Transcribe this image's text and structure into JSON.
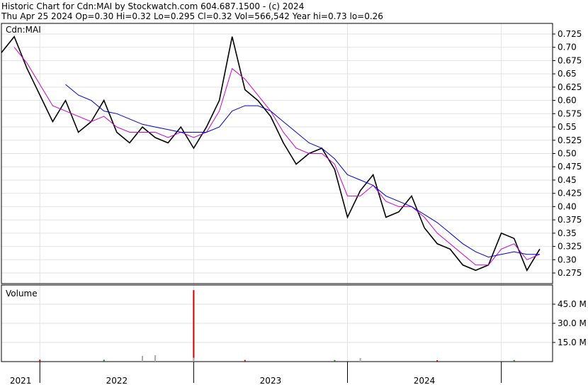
{
  "header": {
    "line1": "Historic Chart for Cdn:MAI by Stockwatch.com 604.687.1500 - (c) 2024",
    "line2": "Thu Apr 25 2024  Op=0.30  Hi=0.32  Lo=0.295  Cl=0.32  Vol=566,542  Year hi=0.73  lo=0.26"
  },
  "chart_data": {
    "type": "line",
    "symbol": "Cdn:MAI",
    "volume_label": "Volume",
    "price_axis": {
      "ticks": [
        "0.725",
        "0.70",
        "0.675",
        "0.65",
        "0.625",
        "0.60",
        "0.575",
        "0.55",
        "0.525",
        "0.50",
        "0.475",
        "0.45",
        "0.425",
        "0.40",
        "0.375",
        "0.35",
        "0.325",
        "0.30",
        "0.275"
      ],
      "ylim": [
        0.255,
        0.745
      ]
    },
    "volume_axis": {
      "ticks": [
        "45.0 M",
        "30.0 M",
        "15.0 M"
      ],
      "ylim": [
        0,
        60
      ]
    },
    "x_axis": {
      "labels": [
        "2021",
        "2022",
        "2023",
        "2024"
      ],
      "range": [
        "2020-10",
        "2024-05"
      ]
    },
    "grid": true,
    "series": [
      {
        "color": "#000000",
        "points": [
          [
            "2020-10",
            0.69
          ],
          [
            "2020-11",
            0.72
          ],
          [
            "2020-12",
            0.66
          ],
          [
            "2021-01",
            0.61
          ],
          [
            "2021-02",
            0.56
          ],
          [
            "2021-03",
            0.6
          ],
          [
            "2021-04",
            0.54
          ],
          [
            "2021-05",
            0.56
          ],
          [
            "2021-06",
            0.6
          ],
          [
            "2021-07",
            0.54
          ],
          [
            "2021-08",
            0.52
          ],
          [
            "2021-09",
            0.55
          ],
          [
            "2021-10",
            0.53
          ],
          [
            "2021-11",
            0.52
          ],
          [
            "2021-12",
            0.55
          ],
          [
            "2022-01",
            0.51
          ],
          [
            "2022-02",
            0.55
          ],
          [
            "2022-03",
            0.6
          ],
          [
            "2022-04",
            0.72
          ],
          [
            "2022-05",
            0.62
          ],
          [
            "2022-06",
            0.6
          ],
          [
            "2022-07",
            0.57
          ],
          [
            "2022-08",
            0.52
          ],
          [
            "2022-09",
            0.48
          ],
          [
            "2022-10",
            0.5
          ],
          [
            "2022-11",
            0.51
          ],
          [
            "2022-12",
            0.47
          ],
          [
            "2023-01",
            0.38
          ],
          [
            "2023-02",
            0.43
          ],
          [
            "2023-03",
            0.46
          ],
          [
            "2023-04",
            0.38
          ],
          [
            "2023-05",
            0.39
          ],
          [
            "2023-06",
            0.42
          ],
          [
            "2023-07",
            0.36
          ],
          [
            "2023-08",
            0.33
          ],
          [
            "2023-09",
            0.32
          ],
          [
            "2023-10",
            0.29
          ],
          [
            "2023-11",
            0.28
          ],
          [
            "2023-12",
            0.29
          ],
          [
            "2024-01",
            0.35
          ],
          [
            "2024-02",
            0.34
          ],
          [
            "2024-03",
            0.28
          ],
          [
            "2024-04",
            0.32
          ]
        ]
      },
      {
        "color": "#cc00cc",
        "points": [
          [
            "2020-11",
            0.7
          ],
          [
            "2020-12",
            0.67
          ],
          [
            "2021-01",
            0.63
          ],
          [
            "2021-02",
            0.59
          ],
          [
            "2021-03",
            0.58
          ],
          [
            "2021-04",
            0.57
          ],
          [
            "2021-05",
            0.56
          ],
          [
            "2021-06",
            0.57
          ],
          [
            "2021-07",
            0.55
          ],
          [
            "2021-08",
            0.54
          ],
          [
            "2021-09",
            0.54
          ],
          [
            "2021-10",
            0.54
          ],
          [
            "2021-11",
            0.53
          ],
          [
            "2021-12",
            0.54
          ],
          [
            "2022-01",
            0.53
          ],
          [
            "2022-02",
            0.54
          ],
          [
            "2022-03",
            0.58
          ],
          [
            "2022-04",
            0.66
          ],
          [
            "2022-05",
            0.64
          ],
          [
            "2022-06",
            0.61
          ],
          [
            "2022-07",
            0.58
          ],
          [
            "2022-08",
            0.54
          ],
          [
            "2022-09",
            0.51
          ],
          [
            "2022-10",
            0.5
          ],
          [
            "2022-11",
            0.5
          ],
          [
            "2022-12",
            0.48
          ],
          [
            "2023-01",
            0.42
          ],
          [
            "2023-02",
            0.42
          ],
          [
            "2023-03",
            0.44
          ],
          [
            "2023-04",
            0.41
          ],
          [
            "2023-05",
            0.4
          ],
          [
            "2023-06",
            0.4
          ],
          [
            "2023-07",
            0.38
          ],
          [
            "2023-08",
            0.35
          ],
          [
            "2023-09",
            0.33
          ],
          [
            "2023-10",
            0.31
          ],
          [
            "2023-11",
            0.29
          ],
          [
            "2023-12",
            0.29
          ],
          [
            "2024-01",
            0.32
          ],
          [
            "2024-02",
            0.33
          ],
          [
            "2024-03",
            0.3
          ],
          [
            "2024-04",
            0.31
          ]
        ]
      },
      {
        "color": "#0000cc",
        "points": [
          [
            "2021-03",
            0.63
          ],
          [
            "2021-04",
            0.61
          ],
          [
            "2021-05",
            0.6
          ],
          [
            "2021-06",
            0.58
          ],
          [
            "2021-07",
            0.575
          ],
          [
            "2021-08",
            0.565
          ],
          [
            "2021-09",
            0.555
          ],
          [
            "2021-10",
            0.55
          ],
          [
            "2021-11",
            0.545
          ],
          [
            "2021-12",
            0.54
          ],
          [
            "2022-01",
            0.54
          ],
          [
            "2022-02",
            0.54
          ],
          [
            "2022-03",
            0.55
          ],
          [
            "2022-04",
            0.58
          ],
          [
            "2022-05",
            0.59
          ],
          [
            "2022-06",
            0.59
          ],
          [
            "2022-07",
            0.58
          ],
          [
            "2022-08",
            0.56
          ],
          [
            "2022-09",
            0.54
          ],
          [
            "2022-10",
            0.52
          ],
          [
            "2022-11",
            0.51
          ],
          [
            "2022-12",
            0.49
          ],
          [
            "2023-01",
            0.46
          ],
          [
            "2023-02",
            0.45
          ],
          [
            "2023-03",
            0.44
          ],
          [
            "2023-04",
            0.42
          ],
          [
            "2023-05",
            0.41
          ],
          [
            "2023-06",
            0.4
          ],
          [
            "2023-07",
            0.385
          ],
          [
            "2023-08",
            0.37
          ],
          [
            "2023-09",
            0.35
          ],
          [
            "2023-10",
            0.33
          ],
          [
            "2023-11",
            0.315
          ],
          [
            "2023-12",
            0.305
          ],
          [
            "2024-01",
            0.31
          ],
          [
            "2024-02",
            0.315
          ],
          [
            "2024-03",
            0.31
          ],
          [
            "2024-04",
            0.31
          ]
        ]
      }
    ],
    "volume_bars": [
      {
        "date": "2021-09",
        "v": 4.5,
        "color": "#aaaaaa"
      },
      {
        "date": "2021-10",
        "v": 5.0,
        "color": "#aaaaaa"
      },
      {
        "date": "2022-01",
        "v": 56.0,
        "color": "#cc0000"
      },
      {
        "date": "2022-01",
        "v": 3.0,
        "color": "#aaaaaa"
      },
      {
        "date": "2023-02",
        "v": 2.8,
        "color": "#aaaaaa"
      },
      {
        "date": "2021-01",
        "v": 1.5,
        "color": "#cc0000"
      },
      {
        "date": "2021-06",
        "v": 1.4,
        "color": "#008800"
      },
      {
        "date": "2022-05",
        "v": 1.3,
        "color": "#cc0000"
      },
      {
        "date": "2022-12",
        "v": 1.2,
        "color": "#008800"
      },
      {
        "date": "2023-08",
        "v": 1.1,
        "color": "#cc0000"
      },
      {
        "date": "2024-02",
        "v": 1.2,
        "color": "#008800"
      }
    ]
  }
}
